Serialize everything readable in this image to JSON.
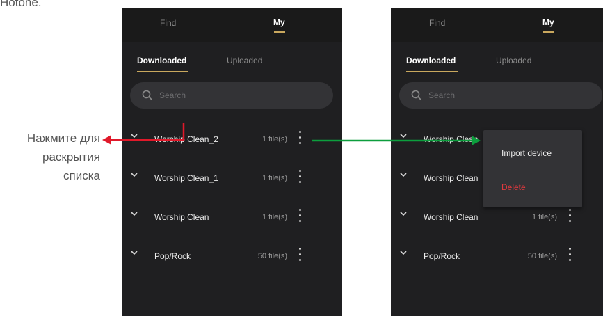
{
  "caption_top": "Hotone.",
  "app": {
    "tabs": [
      {
        "label": "Find"
      },
      {
        "label": "My"
      }
    ],
    "subtabs": [
      {
        "label": "Downloaded"
      },
      {
        "label": "Uploaded"
      }
    ],
    "search": {
      "placeholder": "Search"
    },
    "rows": [
      {
        "name": "Worship Clean_2",
        "count": "1 file(s)"
      },
      {
        "name": "Worship Clean_1",
        "count": "1 file(s)"
      },
      {
        "name": "Worship Clean",
        "count": "1 file(s)"
      },
      {
        "name": "Pop/Rock",
        "count": "50 file(s)"
      }
    ]
  },
  "context_menu": {
    "import": "Import device",
    "delete": "Delete"
  },
  "note": {
    "line1": "Нажмите для",
    "line2": "раскрытия",
    "line3": "списка"
  },
  "colors": {
    "accent": "#c9a85e",
    "delete": "#e0393e",
    "red_arrow": "#e0192a",
    "green_arrow": "#0c9e3d"
  }
}
